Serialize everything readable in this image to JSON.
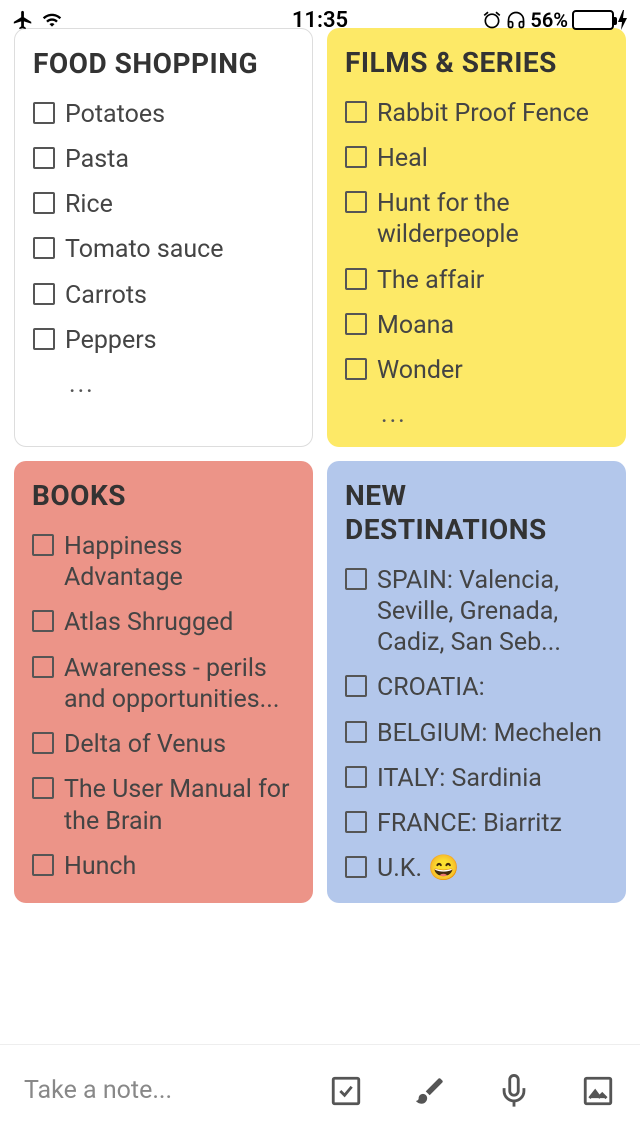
{
  "status": {
    "time": "11:35",
    "battery_pct": "56%",
    "airplane": "✈",
    "wifi": "wifi",
    "alarm": "alarm",
    "headphones": "headphones",
    "charging": "⚡"
  },
  "notes": [
    {
      "title": "FOOD SHOPPING",
      "color": "white",
      "items": [
        "Potatoes",
        "Pasta",
        "Rice",
        "Tomato sauce",
        "Carrots",
        "Peppers"
      ],
      "more": true
    },
    {
      "title": "FILMS & SERIES",
      "color": "yellow",
      "items": [
        "Rabbit Proof Fence",
        "Heal",
        "Hunt for the wilderpeople",
        "The affair",
        "Moana",
        "Wonder"
      ],
      "more": true
    },
    {
      "title": "BOOKS",
      "color": "red",
      "items": [
        "Happiness Advantage",
        "Atlas Shrugged",
        "Awareness - perils and opportunities...",
        "Delta of Venus",
        "The User Manual for the Brain",
        "Hunch"
      ],
      "more": false
    },
    {
      "title": "NEW DESTINATIONS",
      "color": "blue",
      "items": [
        "SPAIN: Valencia, Seville, Grenada, Cadiz, San Seb...",
        "CROATIA:",
        "BELGIUM: Mechelen",
        "ITALY: Sardinia",
        "FRANCE: Biarritz",
        "U.K. 😄"
      ],
      "more": false
    }
  ],
  "bottombar": {
    "placeholder": "Take a note..."
  }
}
